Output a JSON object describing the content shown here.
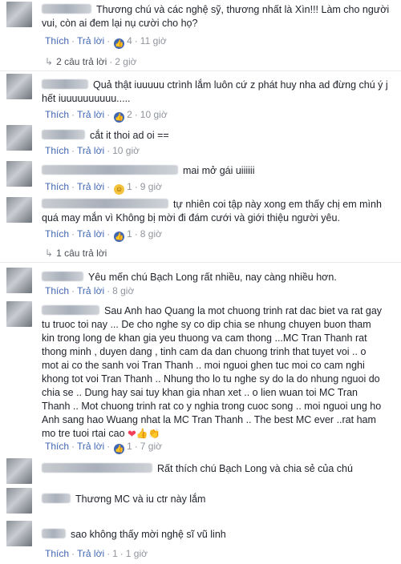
{
  "ui": {
    "like_label": "Thích",
    "reply_label": "Trả lời",
    "dot": "·"
  },
  "comments": [
    {
      "text": "Thương chú và các nghệ sỹ, thương nhất là Xìn!!! Làm cho người vui, còn ai đem lại nụ cười cho họ?",
      "reaction": "like",
      "reaction_count": "4",
      "time": "11 giờ",
      "replies_label": "2 câu trả lời",
      "replies_time": "2 giờ"
    },
    {
      "text": "Quả thật iuuuuu ctrình lắm luôn cứ z phát huy nha ad đừng chú ý j hết iuuuuuuuuuu.....",
      "reaction": "like",
      "reaction_count": "2",
      "time": "10 giờ"
    },
    {
      "text": "cắt it thoi ad oi ==",
      "time": "10 giờ"
    },
    {
      "text": "mai mở gái uiiiiii",
      "reaction": "haha",
      "reaction_count": "1",
      "time": "9 giờ"
    },
    {
      "text": "tự nhiên coi tập này xong em thấy chị em mình quá may mắn vì Không bị mời đi đám cưới và giới thiệu người yêu.",
      "reaction": "like",
      "reaction_count": "1",
      "time": "8 giờ",
      "replies_label": "1 câu trả lời"
    },
    {
      "text": "Yêu mến chú Bạch Long rất nhiều, nay càng nhiều hơn.",
      "time": "8 giờ"
    },
    {
      "text": "Sau Anh hao Quang la mot chuong trinh rat dac biet va rat gay tu truoc toi nay ... De cho nghe sy co dip chia se nhung chuyen buon tham kin trong long de khan gia yeu thuong va cam thong ...MC Tran Thanh rat thong minh , duyen dang , tinh cam da dan chuong trinh that tuyet voi .. o mot ai co the sanh voi Tran Thanh .. moi nguoi ghen tuc moi co cam nghi khong tot voi Tran Thanh .. Nhung tho lo tu nghe sy do la do nhung nguoi do chia se .. Dung hay sai tuy khan gia nhan xet .. o lien wuan toi MC Tran Thanh .. Mot chuong trinh rat co y nghia trong cuoc song .. moi nguoi ung ho Anh sang hao Wuang nhat la MC Tran Thanh .. The best MC ever ..rat ham mo tre tuoi rtai cao",
      "reaction": "like",
      "reaction_count": "1",
      "time": "7 giờ"
    },
    {
      "text": "Rất thích chú Bạch Long và chia sẻ của chú"
    },
    {
      "text": "Thương MC và iu ctr này lắm"
    },
    {
      "text": "sao không thấy mời nghệ sĩ vũ linh",
      "reaction_count": "1",
      "time": "1 giờ"
    }
  ]
}
